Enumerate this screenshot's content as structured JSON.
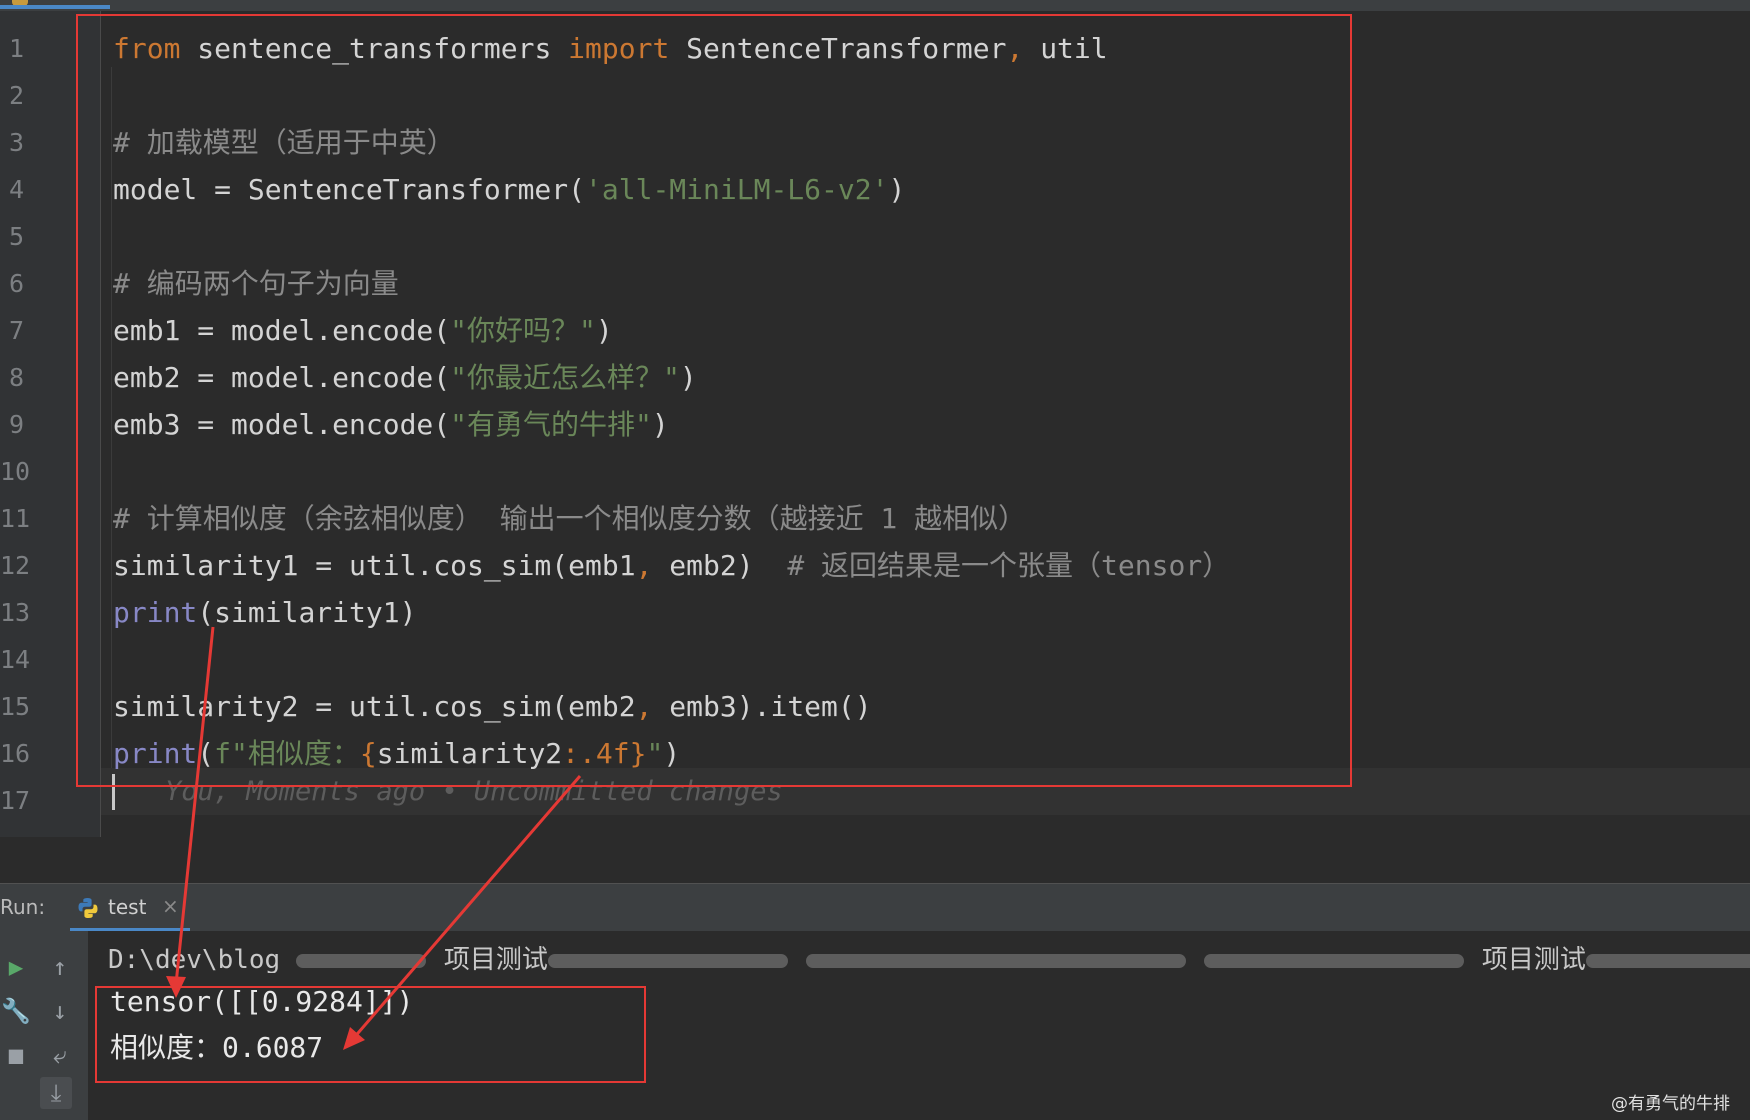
{
  "editor": {
    "line_numbers": [
      "1",
      "2",
      "3",
      "4",
      "5",
      "6",
      "7",
      "8",
      "9",
      "10",
      "11",
      "12",
      "13",
      "14",
      "15",
      "16",
      "17"
    ],
    "code": {
      "l1_from": "from",
      "l1_module": " sentence_transformers ",
      "l1_import": "import",
      "l1_names": " SentenceTransformer",
      "l1_comma": ",",
      "l1_util": " util",
      "l3_comment": "# 加载模型（适用于中英）",
      "l4_pre": "model = SentenceTransformer(",
      "l4_str": "'all-MiniLM-L6-v2'",
      "l4_post": ")",
      "l6_comment": "# 编码两个句子为向量",
      "l7_pre": "emb1 = model.encode(",
      "l7_str": "\"你好吗？\"",
      "l7_post": ")",
      "l8_pre": "emb2 = model.encode(",
      "l8_str": "\"你最近怎么样？\"",
      "l8_post": ")",
      "l9_pre": "emb3 = model.encode(",
      "l9_str": "\"有勇气的牛排\"",
      "l9_post": ")",
      "l11_comment": "# 计算相似度（余弦相似度） 输出一个相似度分数（越接近 1 越相似）",
      "l12_a": "similarity1 = util.cos_sim(emb1",
      "l12_comma": ",",
      "l12_b": " emb2)  ",
      "l12_comment": "# 返回结果是一个张量（tensor）",
      "l13_print": "print",
      "l13_rest": "(similarity1)",
      "l15_a": "similarity2 = util.cos_sim(emb2",
      "l15_comma": ",",
      "l15_b": " emb3).item()",
      "l16_print": "print",
      "l16_open": "(",
      "l16_fstr": "f\"相似度：",
      "l16_brace_open": "{",
      "l16_expr": "similarity2",
      "l16_fmt": ":.4f",
      "l16_brace_close": "}",
      "l16_quote": "\"",
      "l16_close": ")"
    },
    "blame_hint": "You, Moments ago • Uncommitted changes"
  },
  "run_panel": {
    "label": "Run:",
    "tab_name": "test",
    "tab_close": "×",
    "path_prefix": "D:\\dev\\blog_",
    "path_word1": "项目测试",
    "path_word2": "项目测试",
    "output": [
      "tensor([[0.9284]])",
      "相似度：0.6087"
    ]
  },
  "watermark": "@有勇气的牛排",
  "colors": {
    "highlight": "#e53935",
    "keyword": "#cc7832",
    "string": "#6a8759",
    "comment": "#8a8a8a",
    "builtin": "#8888c6"
  }
}
